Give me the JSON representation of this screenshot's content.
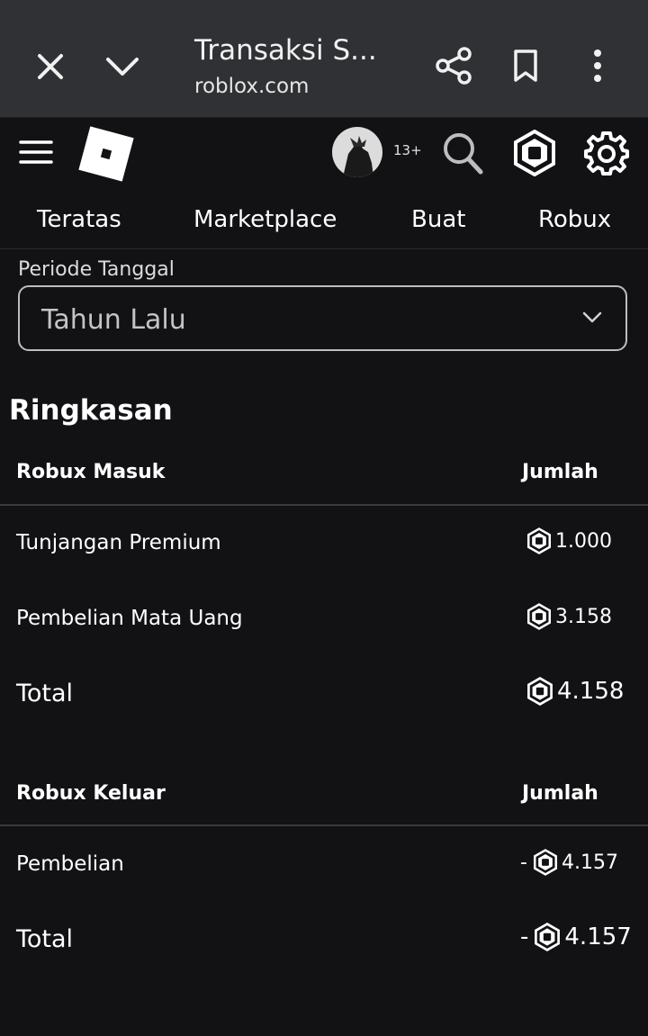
{
  "browser": {
    "tab_title": "Transaksi S...",
    "url": "roblox.com",
    "icons": [
      "close-icon",
      "chevron-down-icon",
      "share-icon",
      "bookmark-icon",
      "more-vert-icon"
    ]
  },
  "header": {
    "age_badge": "13+",
    "icons": [
      "menu-icon",
      "roblox-logo",
      "avatar",
      "search-icon",
      "robux-icon",
      "gear-icon"
    ]
  },
  "nav": {
    "tabs": [
      "Teratas",
      "Marketplace",
      "Buat",
      "Robux"
    ]
  },
  "period": {
    "label": "Periode Tanggal",
    "selected": "Tahun Lalu"
  },
  "summary": {
    "title": "Ringkasan",
    "incoming": {
      "header": "Robux Masuk",
      "amount_header": "Jumlah",
      "rows": [
        {
          "label": "Tunjangan Premium",
          "amount": "1.000"
        },
        {
          "label": "Pembelian Mata Uang",
          "amount": "3.158"
        }
      ],
      "total_label": "Total",
      "total_amount": "4.158"
    },
    "outgoing": {
      "header": "Robux Keluar",
      "amount_header": "Jumlah",
      "rows": [
        {
          "label": "Pembelian",
          "amount": "4.157",
          "sign": "-"
        }
      ],
      "total_label": "Total",
      "total_amount": "4.157",
      "total_sign": "-"
    }
  },
  "colors": {
    "background": "#121215",
    "browser_bar": "#303134",
    "text": "#ffffff",
    "muted": "#c4c4c4"
  }
}
